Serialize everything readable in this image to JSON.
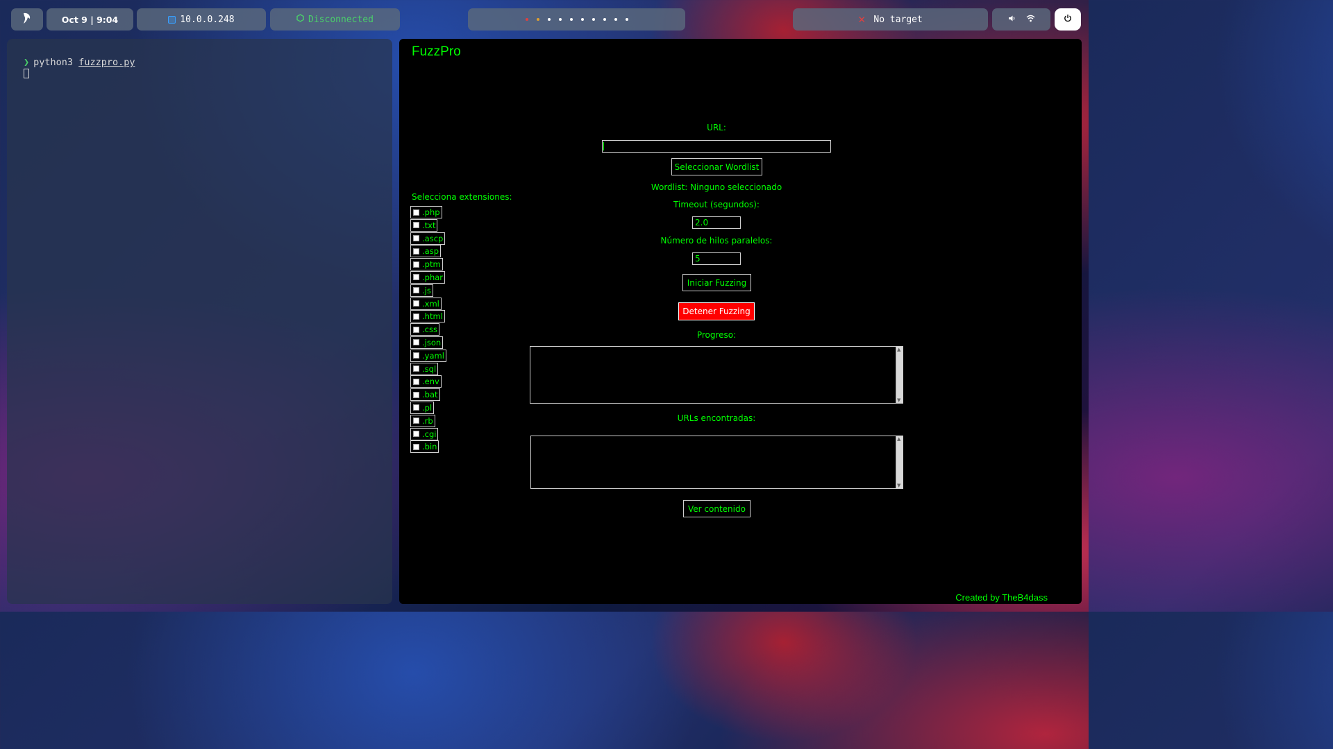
{
  "topbar": {
    "clock": "Oct 9 | 9:04",
    "ip": "10.0.0.248",
    "vpn_status": "Disconnected",
    "target": "No target",
    "workspaces": [
      "red",
      "orange",
      "white",
      "white",
      "white",
      "white",
      "white",
      "white",
      "white",
      "white"
    ],
    "colors": {
      "vpn": "#4ad06a",
      "target_icon": "#e04040"
    }
  },
  "terminal": {
    "prompt": "❯",
    "command": "python3",
    "argument": "fuzzpro.py"
  },
  "app": {
    "title": "FuzzPro",
    "url_label": "URL:",
    "url_value": "",
    "select_wordlist_label": "Seleccionar Wordlist",
    "wordlist_status": "Wordlist: Ninguno seleccionado",
    "timeout_label": "Timeout (segundos):",
    "timeout_value": "2.0",
    "threads_label": "Número de hilos paralelos:",
    "threads_value": "5",
    "start_label": "Iniciar Fuzzing",
    "stop_label": "Detener Fuzzing",
    "progress_label": "Progreso:",
    "urls_label": "URLs encontradas:",
    "view_label": "Ver contenido",
    "extensions_title": "Selecciona extensiones:",
    "extensions": [
      ".php",
      ".txt",
      ".ascp",
      ".asp",
      ".ptm",
      ".phar",
      ".js",
      ".xml",
      ".html",
      ".css",
      ".json",
      ".yaml",
      ".sql",
      ".env",
      ".bat",
      ".pl",
      ".rb",
      ".cgi",
      ".bin"
    ],
    "footer": "Created by TheB4dass",
    "colors": {
      "text": "#00ff00",
      "background": "#000000",
      "stop_button": "#ff0000"
    }
  }
}
